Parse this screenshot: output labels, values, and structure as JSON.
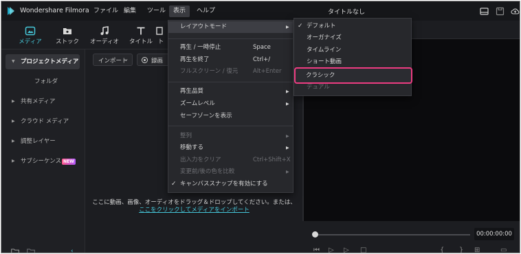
{
  "app": {
    "name": "Wondershare Filmora",
    "document_title": "タイトルなし"
  },
  "menubar": {
    "items": [
      {
        "label": "ファイル"
      },
      {
        "label": "編集"
      },
      {
        "label": "ツール"
      },
      {
        "label": "表示",
        "active": true
      },
      {
        "label": "ヘルプ"
      }
    ]
  },
  "window_controls": {
    "icons": [
      "layout-icon",
      "save-icon",
      "cloud-upload-icon"
    ]
  },
  "toolbar": {
    "tabs": [
      {
        "label": "メディア",
        "icon": "media-icon",
        "selected": true
      },
      {
        "label": "ストック",
        "icon": "stock-icon"
      },
      {
        "label": "オーディオ",
        "icon": "music-note-icon"
      },
      {
        "label": "タイトル",
        "icon": "title-t-icon"
      },
      {
        "label": "ト",
        "icon": "transition-icon"
      }
    ]
  },
  "sidebar": {
    "items": [
      {
        "label": "プロジェクトメディア",
        "expanded": true,
        "selected": true
      },
      {
        "label": "フォルダ"
      },
      {
        "label": "共有メディア"
      },
      {
        "label": "クラウド メディア"
      },
      {
        "label": "調整レイヤー"
      },
      {
        "label": "サブシーケンス",
        "badge": "NEW"
      }
    ]
  },
  "content": {
    "import_label": "インポート",
    "record_label": "録画",
    "drop_text": "ここに動画、画像、オーディオをドラッグ＆ドロップしてください。または、",
    "import_link": "ここをクリックしてメディアをインポート"
  },
  "view_menu": {
    "items": [
      {
        "label": "レイアウトモード",
        "submenu": true,
        "highlighted": true
      },
      {
        "label": "再生 / 一時停止",
        "shortcut": "Space"
      },
      {
        "label": "再生を終了",
        "shortcut": "Ctrl+/"
      },
      {
        "label": "フルスクリーン / 復元",
        "shortcut": "Alt+Enter",
        "disabled": true
      },
      {
        "label": "再生品質",
        "submenu": true
      },
      {
        "label": "ズームレベル",
        "submenu": true
      },
      {
        "label": "セーフゾーンを表示"
      },
      {
        "label": "整列",
        "submenu": true,
        "disabled": true
      },
      {
        "label": "移動する",
        "submenu": true
      },
      {
        "label": "出入力をクリア",
        "shortcut": "Ctrl+Shift+X",
        "disabled": true
      },
      {
        "label": "変更前/後の色を比較",
        "submenu": true,
        "disabled": true
      },
      {
        "label": "キャンバススナップを有効にする",
        "checked": true
      }
    ]
  },
  "layout_submenu": {
    "items": [
      {
        "label": "デフォルト",
        "checked": true
      },
      {
        "label": "オーガナイズ"
      },
      {
        "label": "タイムライン"
      },
      {
        "label": "ショート動画"
      },
      {
        "label": "クラシック",
        "emphasized": true
      },
      {
        "label": "デュアル",
        "disabled": true
      }
    ]
  },
  "player": {
    "timecode": "00:00:00:00"
  },
  "colors": {
    "accent": "#46c7d9",
    "highlight_box": "#ee3c82",
    "menu_bg": "#27282c",
    "app_bg": "#1c1d21"
  }
}
